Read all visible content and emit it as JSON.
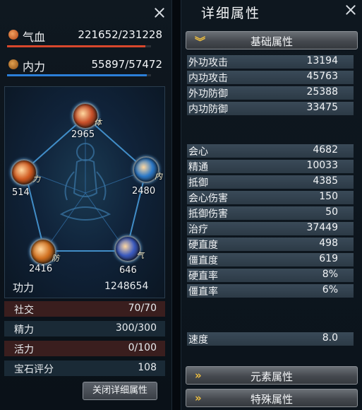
{
  "left": {
    "hp": {
      "label": "气血",
      "value": "221652/231228",
      "fill": 0.959,
      "color": "#d8472c"
    },
    "mp": {
      "label": "内力",
      "value": "55897/57472",
      "fill": 0.973,
      "color": "#2c7fd8"
    },
    "nodes": [
      {
        "name": "ti",
        "glyph": "体",
        "value": "2965",
        "color": "#c8502a"
      },
      {
        "name": "nei",
        "glyph": "内",
        "value": "2480",
        "color": "#2a78c8"
      },
      {
        "name": "qi",
        "glyph": "气",
        "value": "646",
        "color": "#3a5ac0"
      },
      {
        "name": "fang",
        "glyph": "防",
        "value": "2416",
        "color": "#d07020"
      },
      {
        "name": "li",
        "glyph": "力",
        "value": "514",
        "color": "#d05a20"
      }
    ],
    "gongli": {
      "label": "功力",
      "value": "1248654"
    },
    "info": [
      {
        "label": "社交",
        "value": "70/70"
      },
      {
        "label": "精力",
        "value": "300/300"
      },
      {
        "label": "活力",
        "value": "0/100"
      },
      {
        "label": "宝石评分",
        "value": "108"
      }
    ],
    "close_detail_label": "关闭详细属性"
  },
  "right": {
    "title": "详细属性",
    "basic_section": "基础属性",
    "group1": [
      {
        "label": "外功攻击",
        "value": "13194"
      },
      {
        "label": "内功攻击",
        "value": "45763"
      },
      {
        "label": "外功防御",
        "value": "25388"
      },
      {
        "label": "内功防御",
        "value": "33475"
      }
    ],
    "group2": [
      {
        "label": "会心",
        "value": "4682"
      },
      {
        "label": "精通",
        "value": "10033"
      },
      {
        "label": "抵御",
        "value": "4385"
      },
      {
        "label": "会心伤害",
        "value": "150"
      },
      {
        "label": "抵御伤害",
        "value": "50"
      },
      {
        "label": "治疗",
        "value": "37449"
      },
      {
        "label": "硬直度",
        "value": "498"
      },
      {
        "label": "僵直度",
        "value": "619"
      },
      {
        "label": "硬直率",
        "value": "8%"
      },
      {
        "label": "僵直率",
        "value": "6%"
      }
    ],
    "speed": {
      "label": "速度",
      "value": "8.0"
    },
    "element_section": "元素属性",
    "special_section": "特殊属性"
  }
}
